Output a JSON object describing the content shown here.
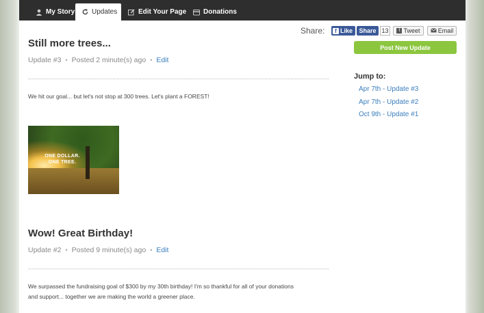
{
  "nav": {
    "tabs": [
      {
        "label": "My Story",
        "icon": "person-icon"
      },
      {
        "label": "Updates",
        "icon": "refresh-icon",
        "active": true
      },
      {
        "label": "Edit Your Page",
        "icon": "edit-icon"
      },
      {
        "label": "Donations",
        "icon": "card-icon"
      }
    ]
  },
  "share": {
    "label": "Share:",
    "like_label": "Like",
    "share_label": "Share",
    "share_count": "13",
    "tweet_label": "Tweet",
    "email_label": "Email"
  },
  "sidebar": {
    "post_button": "Post New Update",
    "jump_title": "Jump to:",
    "jump_items": [
      "Apr 7th - Update #3",
      "Apr 7th - Update #2",
      "Oct 9th - Update #1"
    ]
  },
  "updates": [
    {
      "title": "Still more trees...",
      "number": "Update #3",
      "posted": "Posted 2 minute(s) ago",
      "edit": "Edit",
      "body": "We hit our goal... but let's not stop at 300 trees.  Let's plant a FOREST!",
      "image_text_1": "ONE DOLLAR.",
      "image_text_2": "ONE TREE."
    },
    {
      "title": "Wow! Great Birthday!",
      "number": "Update #2",
      "posted": "Posted 9 minute(s) ago",
      "edit": "Edit",
      "body_1": "We surpassed the fundraising goal of $300 by my 30th birthday!  I'm so thankful for all of your donations",
      "body_2": "and support... together we are making the world a greener place."
    }
  ],
  "colors": {
    "accent_green": "#8cc63f",
    "link_blue": "#3a7ebd",
    "facebook": "#3b5998",
    "nav_dark": "#2e2e2e"
  }
}
